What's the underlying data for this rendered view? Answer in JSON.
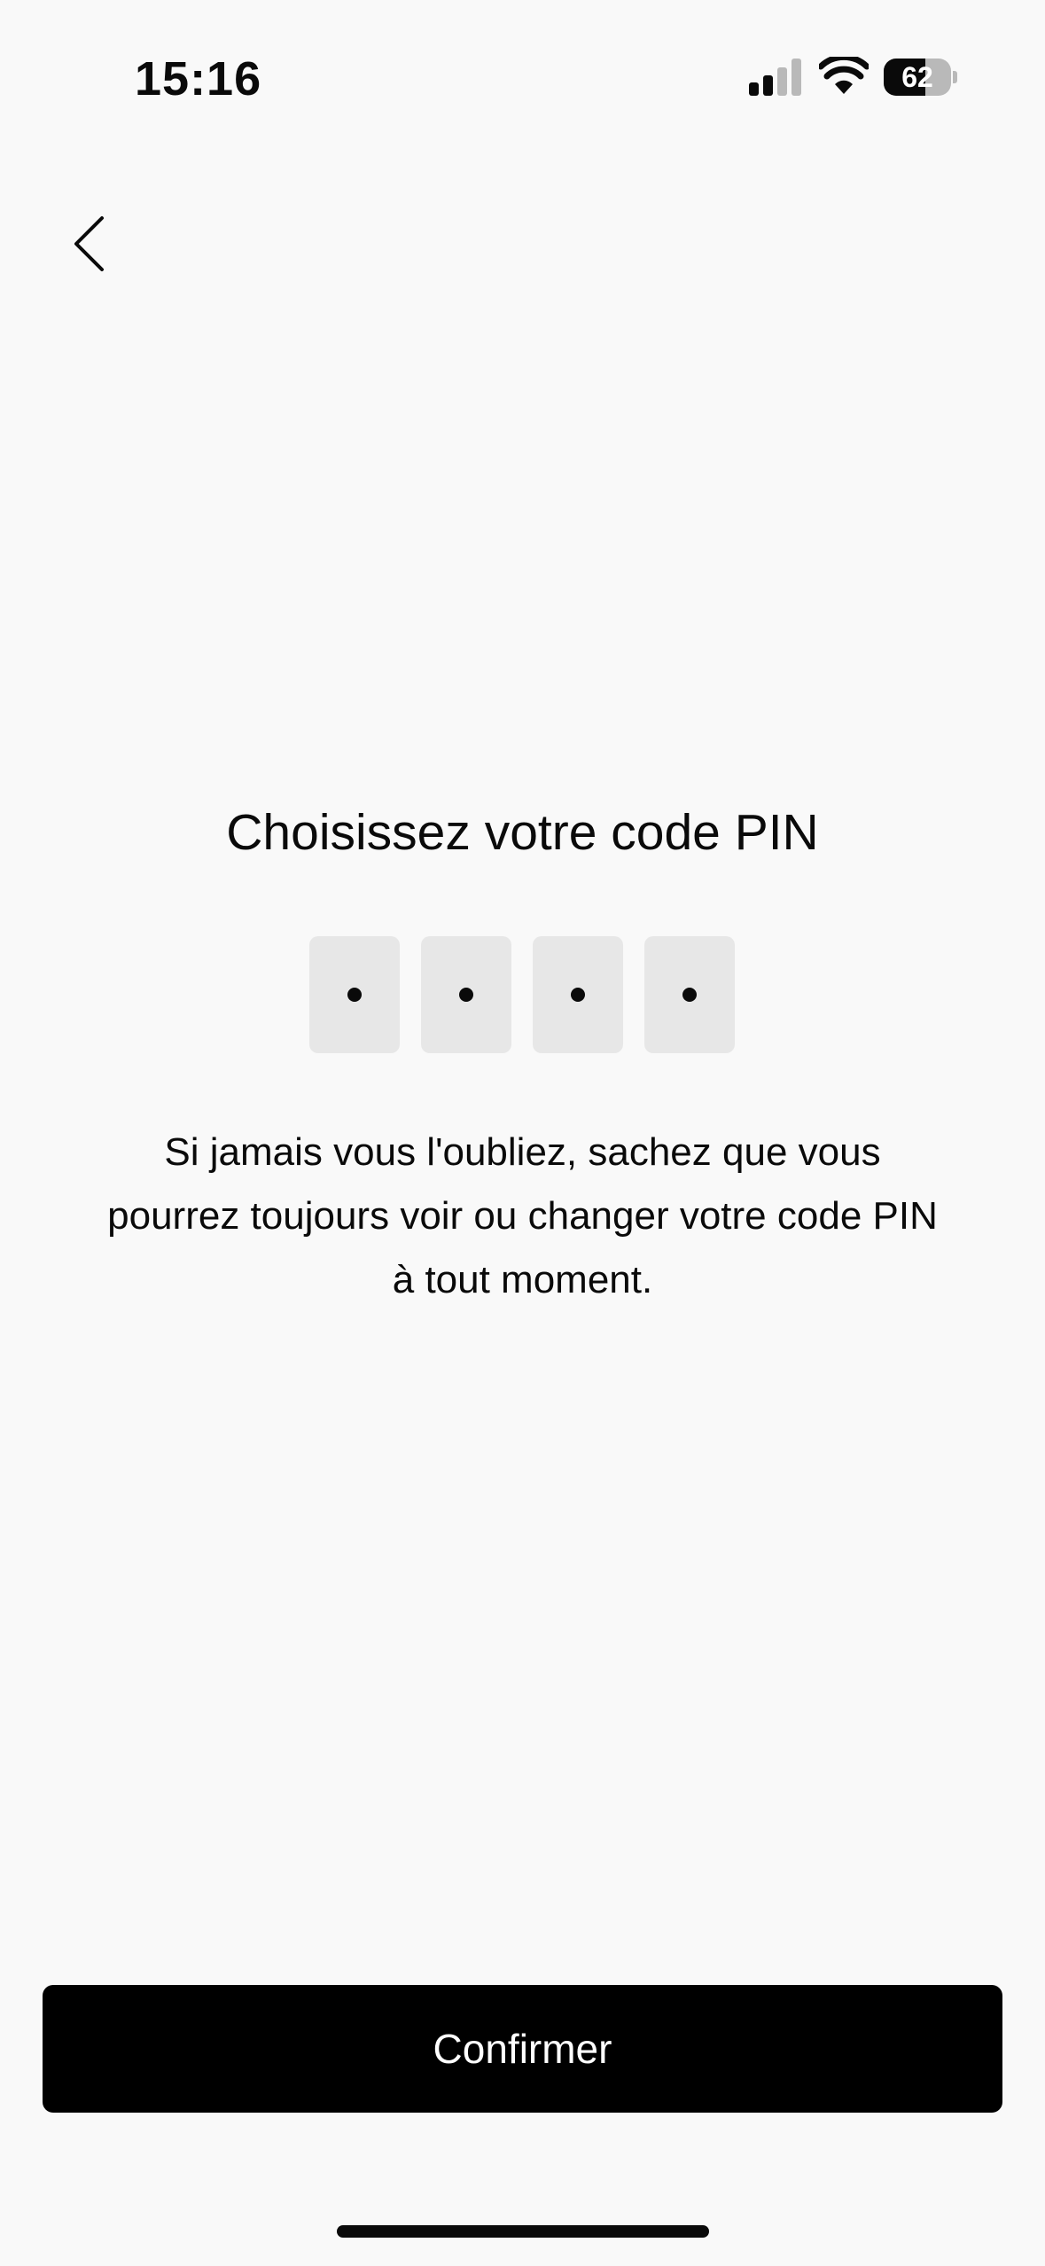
{
  "status_bar": {
    "time": "15:16",
    "battery_level": "62",
    "battery_fraction": 0.62,
    "icons": [
      "signal-icon",
      "wifi-icon",
      "battery-icon"
    ]
  },
  "header": {
    "back_icon": "chevron-left-icon"
  },
  "main": {
    "title": "Choisissez votre code PIN",
    "pin": {
      "length": 4,
      "filled": 4,
      "mask_char": "•"
    },
    "helper_text": "Si jamais vous l'oubliez, sachez que vous pourrez toujours voir ou changer votre code PIN à tout moment."
  },
  "footer": {
    "confirm_label": "Confirmer"
  },
  "colors": {
    "background": "#f9f9f9",
    "text": "#0a0a0a",
    "pin_box": "#e7e7e7",
    "button": "#000000",
    "button_text": "#ffffff"
  }
}
